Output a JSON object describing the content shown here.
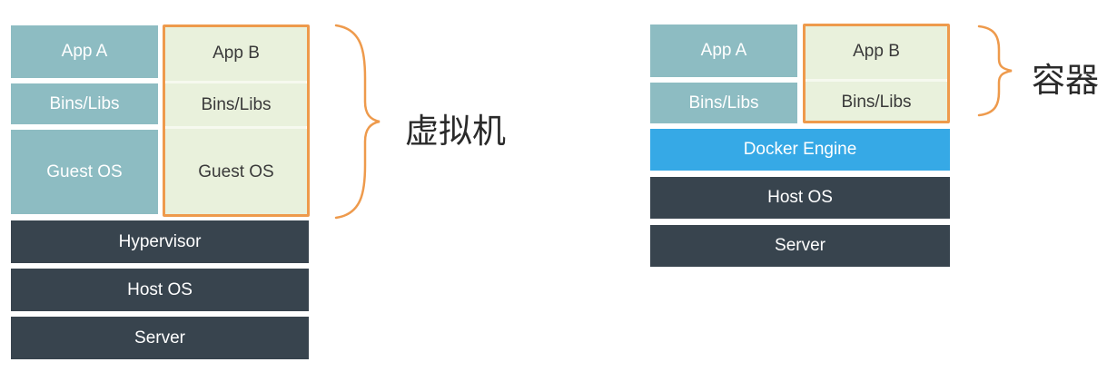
{
  "vm": {
    "app_a": "App A",
    "bins_a": "Bins/Libs",
    "guest_a": "Guest OS",
    "app_b": "App B",
    "bins_b": "Bins/Libs",
    "guest_b": "Guest OS",
    "hypervisor": "Hypervisor",
    "host_os": "Host OS",
    "server": "Server",
    "label": "虚拟机"
  },
  "container": {
    "app_a": "App A",
    "bins_a": "Bins/Libs",
    "app_b": "App B",
    "bins_b": "Bins/Libs",
    "docker_engine": "Docker Engine",
    "host_os": "Host OS",
    "server": "Server",
    "label": "容器"
  },
  "colors": {
    "teal": "#8dbcc2",
    "light_green": "#e9f1dc",
    "dark": "#38444e",
    "docker_blue": "#36a9e6",
    "highlight_orange": "#ee9a4c"
  }
}
